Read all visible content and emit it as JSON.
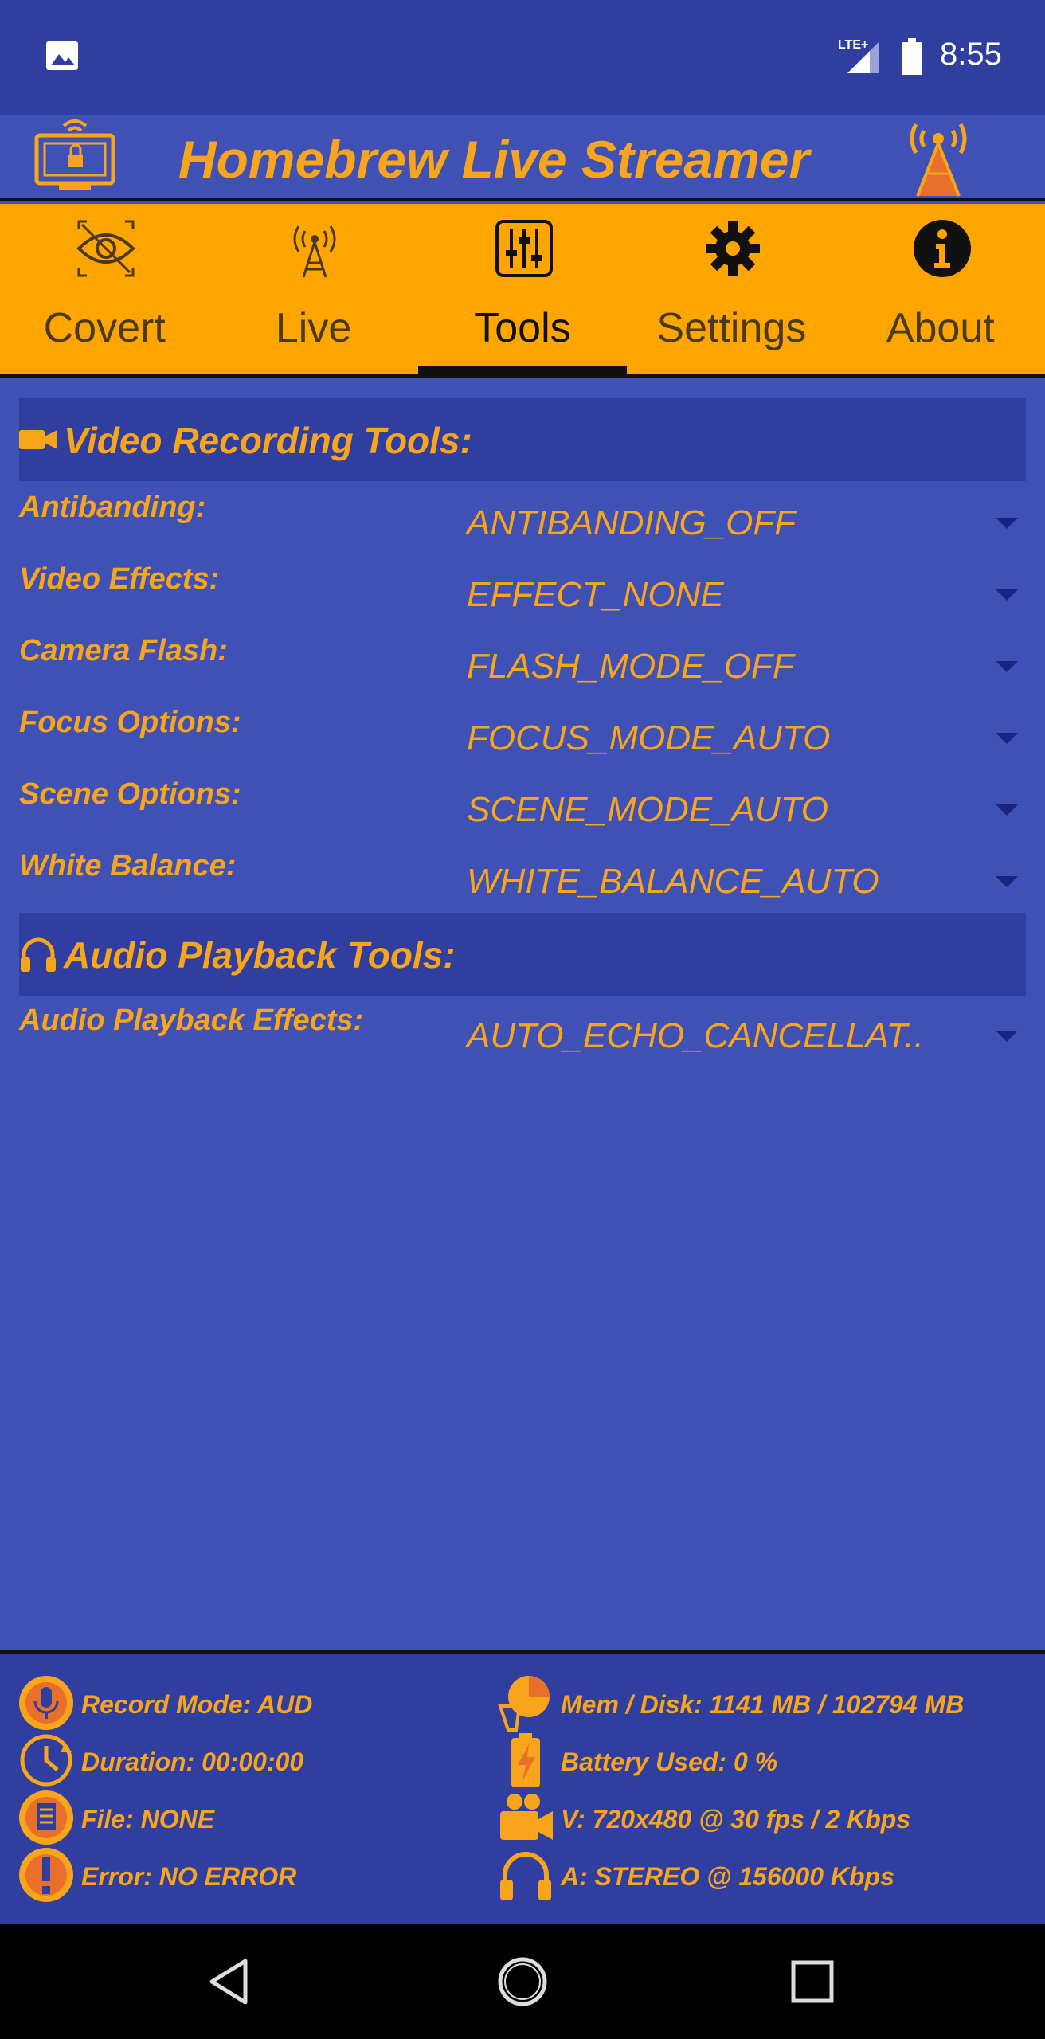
{
  "status_bar": {
    "network": "LTE+",
    "time": "8:55"
  },
  "app": {
    "title": "Homebrew Live Streamer"
  },
  "tabs": [
    {
      "label": "Covert",
      "icon": "eye-icon"
    },
    {
      "label": "Live",
      "icon": "antenna-tower-icon"
    },
    {
      "label": "Tools",
      "icon": "sliders-icon",
      "active": true
    },
    {
      "label": "Settings",
      "icon": "gear-icon"
    },
    {
      "label": "About",
      "icon": "info-icon"
    }
  ],
  "video_section": {
    "title": "Video Recording Tools:",
    "icon": "camcorder-icon",
    "settings": [
      {
        "label": "Antibanding:",
        "value": "ANTIBANDING_OFF"
      },
      {
        "label": "Video Effects:",
        "value": "EFFECT_NONE"
      },
      {
        "label": "Camera Flash:",
        "value": "FLASH_MODE_OFF"
      },
      {
        "label": "Focus Options:",
        "value": "FOCUS_MODE_AUTO"
      },
      {
        "label": "Scene Options:",
        "value": "SCENE_MODE_AUTO"
      },
      {
        "label": "White Balance:",
        "value": "WHITE_BALANCE_AUTO"
      }
    ]
  },
  "audio_section": {
    "title": "Audio Playback Tools:",
    "icon": "headphones-icon",
    "settings": [
      {
        "label": "Audio Playback Effects:",
        "value": "AUTO_ECHO_CANCELLAT.."
      }
    ]
  },
  "footer": {
    "left": [
      {
        "text": "Record Mode: AUD",
        "icon": "microphone-icon"
      },
      {
        "text": "Duration: 00:00:00",
        "icon": "clock-icon"
      },
      {
        "text": "File: NONE",
        "icon": "file-icon"
      },
      {
        "text": "Error: NO ERROR",
        "icon": "warning-icon"
      }
    ],
    "right": [
      {
        "text": "Mem / Disk: 1141 MB / 102794 MB",
        "icon": "memory-chart-icon"
      },
      {
        "text": "Battery Used: 0 %",
        "icon": "battery-charging-icon"
      },
      {
        "text": "V: 720x480 @ 30 fps / 2 Kbps",
        "icon": "video-camera-icon"
      },
      {
        "text": "A: STEREO @ 156000 Kbps",
        "icon": "headphones-icon"
      }
    ]
  },
  "colors": {
    "accent": "#f8a51c",
    "tab_bar": "#ffa500",
    "background": "#3f51b5",
    "header_band": "#303f9f"
  }
}
